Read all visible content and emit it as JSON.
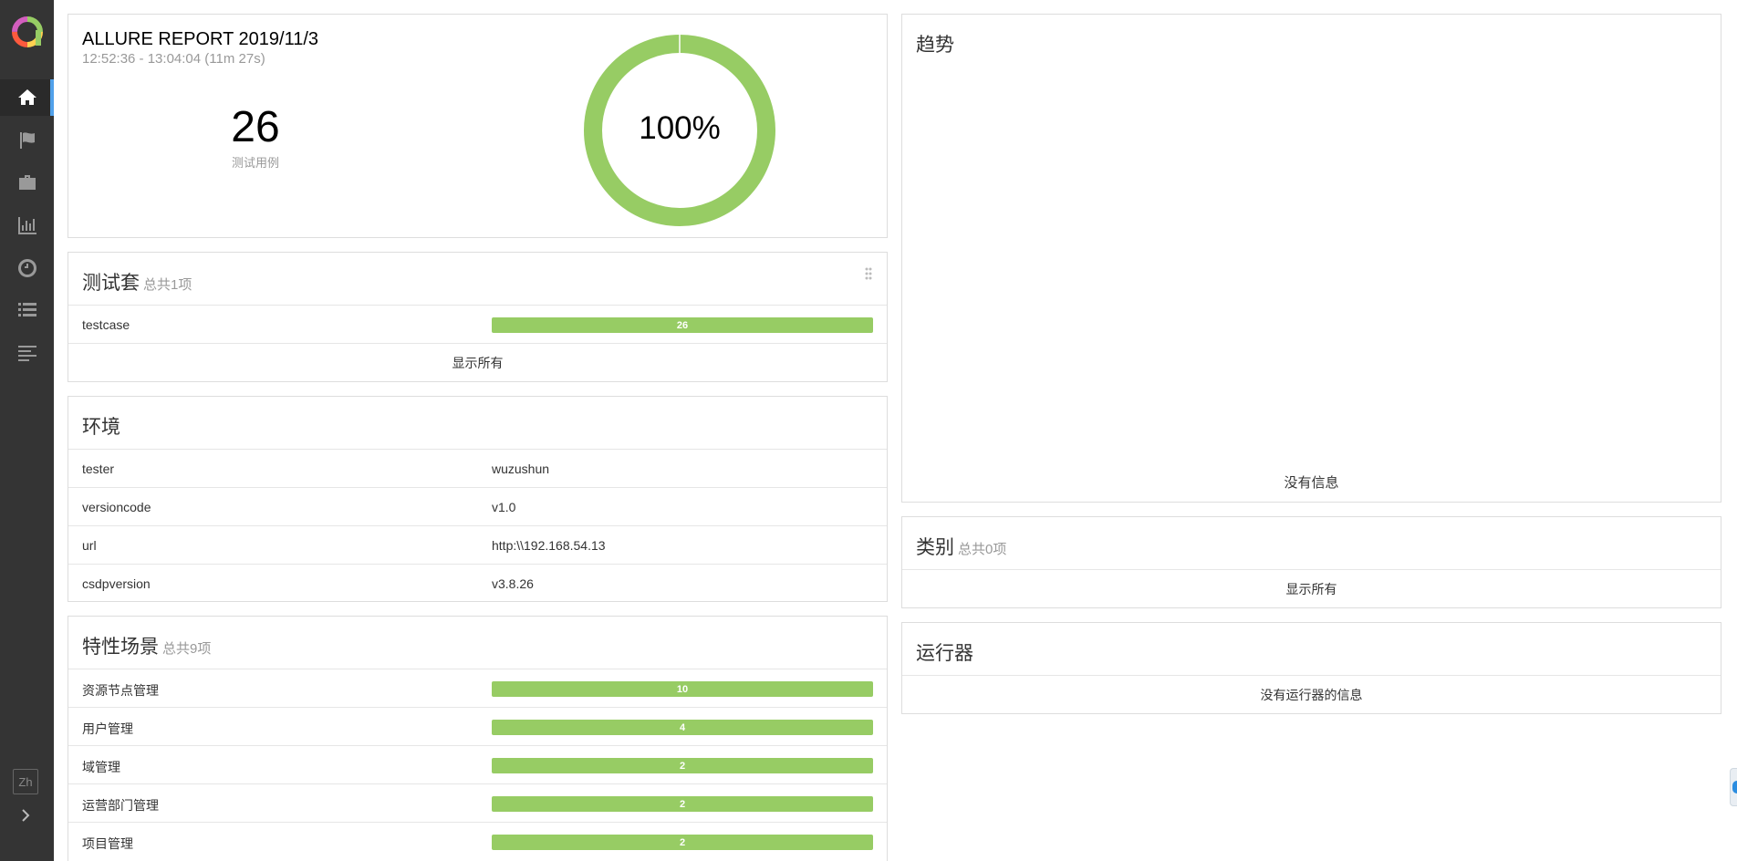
{
  "sidebar": {
    "logo_icon": "allure-logo-icon",
    "nav": [
      {
        "name": "home-icon",
        "active": true
      },
      {
        "name": "flag-icon",
        "active": false
      },
      {
        "name": "briefcase-icon",
        "active": false
      },
      {
        "name": "bar-chart-icon",
        "active": false
      },
      {
        "name": "clock-icon",
        "active": false
      },
      {
        "name": "list-icon",
        "active": false
      },
      {
        "name": "align-left-icon",
        "active": false
      }
    ],
    "lang": "Zh",
    "expand_icon": "chevron-right-icon",
    "accent_color": "#51a1ea",
    "bg_color": "#343434"
  },
  "summary": {
    "title": "ALLURE REPORT 2019/11/3",
    "time": "12:52:36 - 13:04:04 (11m 27s)",
    "count": "26",
    "count_label": "测试用例",
    "percent": "100%",
    "passed_fraction": 1.0,
    "passed_color": "#97cc64"
  },
  "suites": {
    "title": "测试套",
    "total": "总共1项",
    "items": [
      {
        "name": "testcase",
        "value": "26"
      }
    ],
    "show_all": "显示所有"
  },
  "environment": {
    "title": "环境",
    "rows": [
      {
        "key": "tester",
        "value": "wuzushun"
      },
      {
        "key": "versioncode",
        "value": "v1.0"
      },
      {
        "key": "url",
        "value": "http:\\\\192.168.54.13"
      },
      {
        "key": "csdpversion",
        "value": "v3.8.26"
      }
    ]
  },
  "features": {
    "title": "特性场景",
    "total": "总共9项",
    "items": [
      {
        "name": "资源节点管理",
        "value": "10"
      },
      {
        "name": "用户管理",
        "value": "4"
      },
      {
        "name": "域管理",
        "value": "2"
      },
      {
        "name": "运营部门管理",
        "value": "2"
      },
      {
        "name": "项目管理",
        "value": "2"
      }
    ]
  },
  "trend": {
    "title": "趋势",
    "empty": "没有信息"
  },
  "categories": {
    "title": "类别",
    "total": "总共0项",
    "show_all": "显示所有"
  },
  "executors": {
    "title": "运行器",
    "empty": "没有运行器的信息"
  }
}
